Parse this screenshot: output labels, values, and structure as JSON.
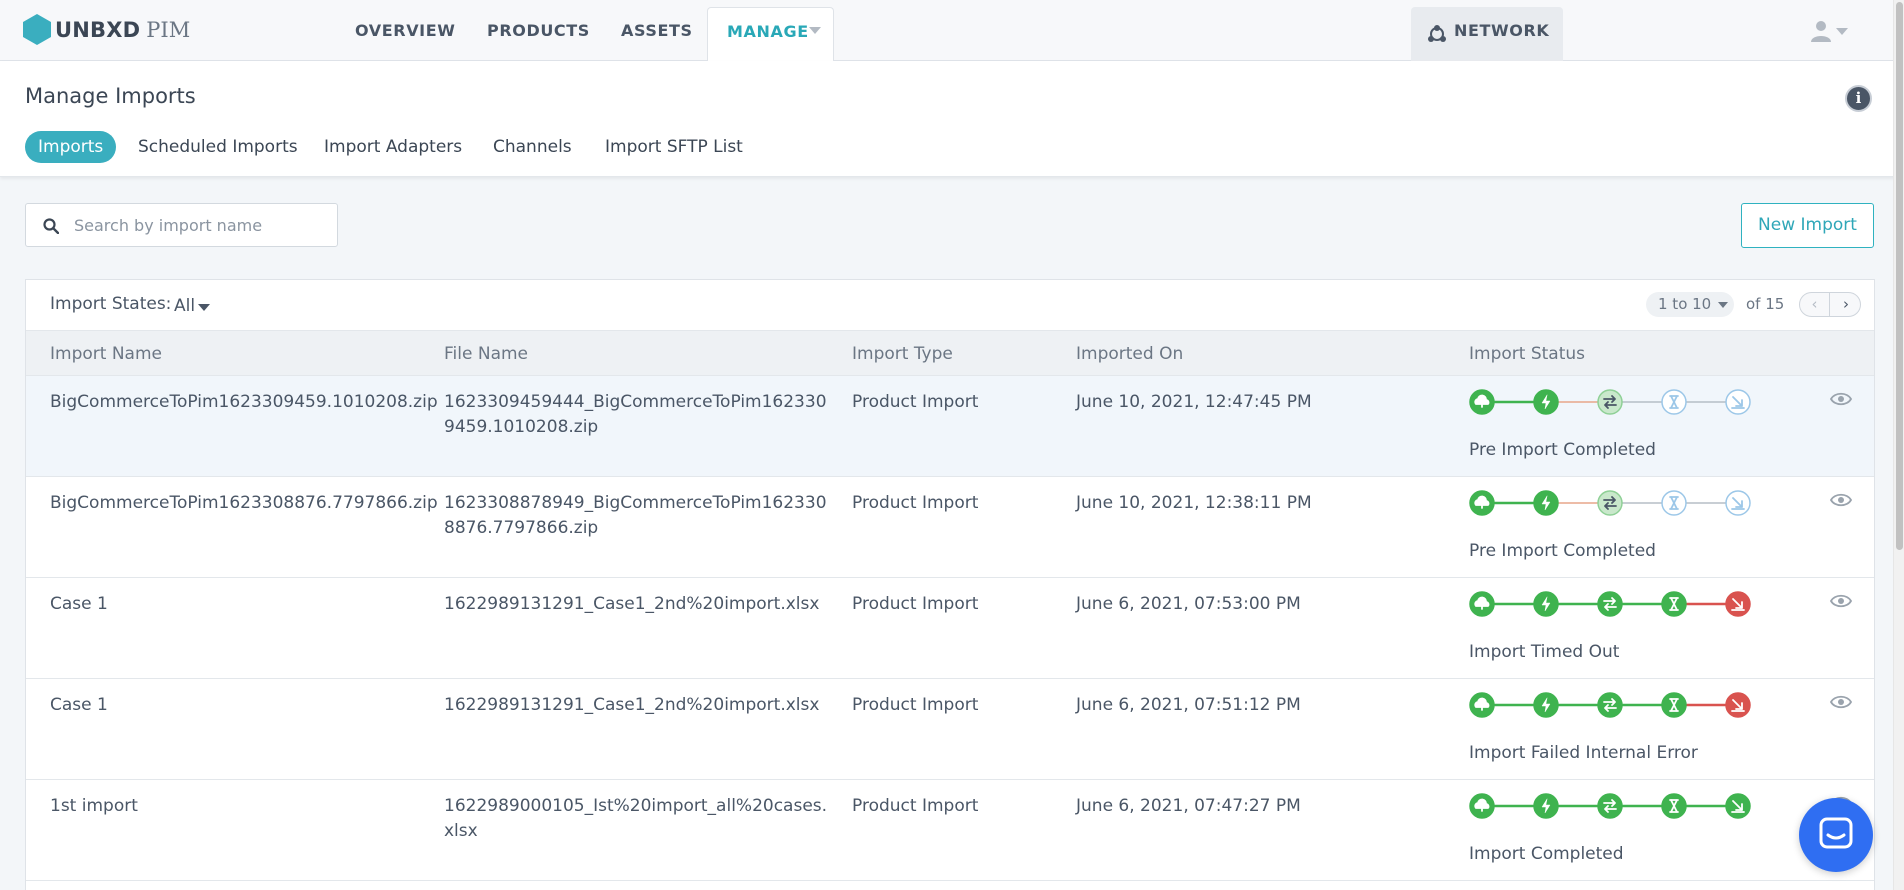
{
  "app": {
    "logo_text": "UNBXD",
    "logo_sub": "PIM",
    "brand_color": "#29a8b7"
  },
  "nav": {
    "items": [
      {
        "label": "OVERVIEW"
      },
      {
        "label": "PRODUCTS"
      },
      {
        "label": "ASSETS"
      },
      {
        "label": "MANAGE",
        "active": true
      }
    ],
    "network_label": "NETWORK",
    "user_icon": "user-icon"
  },
  "page": {
    "title": "Manage Imports",
    "tabs": [
      {
        "label": "Imports",
        "active": true
      },
      {
        "label": "Scheduled Imports"
      },
      {
        "label": "Import Adapters"
      },
      {
        "label": "Channels"
      },
      {
        "label": "Import SFTP List"
      }
    ]
  },
  "search": {
    "placeholder": "Search by import name",
    "value": ""
  },
  "actions": {
    "new_import_label": "New Import"
  },
  "filters": {
    "states_label": "Import States:",
    "states_value": "All"
  },
  "pagination": {
    "range": "1 to 10",
    "total": "of 15",
    "prev": "‹",
    "next": "›"
  },
  "table": {
    "columns": [
      "Import Name",
      "File Name",
      "Import Type",
      "Imported On",
      "Import Status"
    ],
    "status_colors": {
      "done": "#3fb34f",
      "pending_fill": "#c9e8cb",
      "idle": "#9cc7e8",
      "error": "#d9534f"
    },
    "rows": [
      {
        "name": "BigCommerceToPim1623309459.1010208.zip",
        "file": "1623309459444_BigCommerceToPim1623309459.1010208.zip",
        "type": "Product Import",
        "date": "June 10, 2021, 12:47:45 PM",
        "status": "Pre Import Completed",
        "steps": [
          "done",
          "done",
          "partial",
          "idle",
          "idle"
        ],
        "highlight": true
      },
      {
        "name": "BigCommerceToPim1623308876.7797866.zip",
        "file": "1623308878949_BigCommerceToPim1623308876.7797866.zip",
        "type": "Product Import",
        "date": "June 10, 2021, 12:38:11 PM",
        "status": "Pre Import Completed",
        "steps": [
          "done",
          "done",
          "partial",
          "idle",
          "idle"
        ],
        "highlight": false
      },
      {
        "name": "Case 1",
        "file": "1622989131291_Case1_2nd%20import.xlsx",
        "type": "Product Import",
        "date": "June 6, 2021, 07:53:00 PM",
        "status": "Import Timed Out",
        "steps": [
          "done",
          "done",
          "done",
          "done",
          "error"
        ],
        "highlight": false
      },
      {
        "name": "Case 1",
        "file": "1622989131291_Case1_2nd%20import.xlsx",
        "type": "Product Import",
        "date": "June 6, 2021, 07:51:12 PM",
        "status": "Import Failed Internal Error",
        "steps": [
          "done",
          "done",
          "done",
          "done",
          "error"
        ],
        "highlight": false
      },
      {
        "name": "1st import",
        "file": "1622989000105_Ist%20import_all%20cases.xlsx",
        "type": "Product Import",
        "date": "June 6, 2021, 07:47:27 PM",
        "status": "Import Completed",
        "steps": [
          "done",
          "done",
          "done",
          "done",
          "done"
        ],
        "highlight": false
      }
    ]
  }
}
